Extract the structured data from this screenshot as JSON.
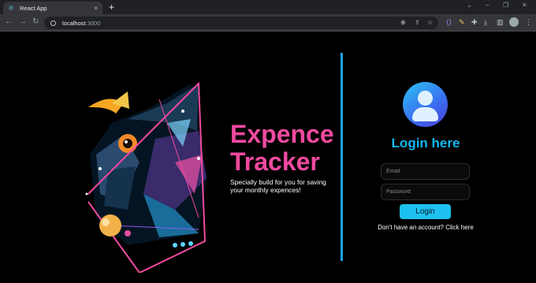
{
  "browser": {
    "tab_title": "React App",
    "tab_close": "×",
    "new_tab": "+",
    "url_host": "localhost",
    "url_port": ":3000",
    "window_controls": [
      "⌄",
      "–",
      "❐",
      "✕"
    ]
  },
  "brand": {
    "title_line1": "Expence",
    "title_line2": "Tracker",
    "subtitle": "Specially build for you for saving your monthly expences!"
  },
  "login": {
    "heading": "Login here",
    "email_placeholder": "Email",
    "password_placeholder": "Password",
    "button_label": "Login",
    "signup_prompt": "Don't have an account? Click here"
  },
  "colors": {
    "brand_pink": "#f04aa0",
    "accent_cyan": "#11b7f2",
    "divider_blue": "#1aa3e0",
    "button_cyan": "#1dc1ef",
    "page_background": "#000000"
  }
}
